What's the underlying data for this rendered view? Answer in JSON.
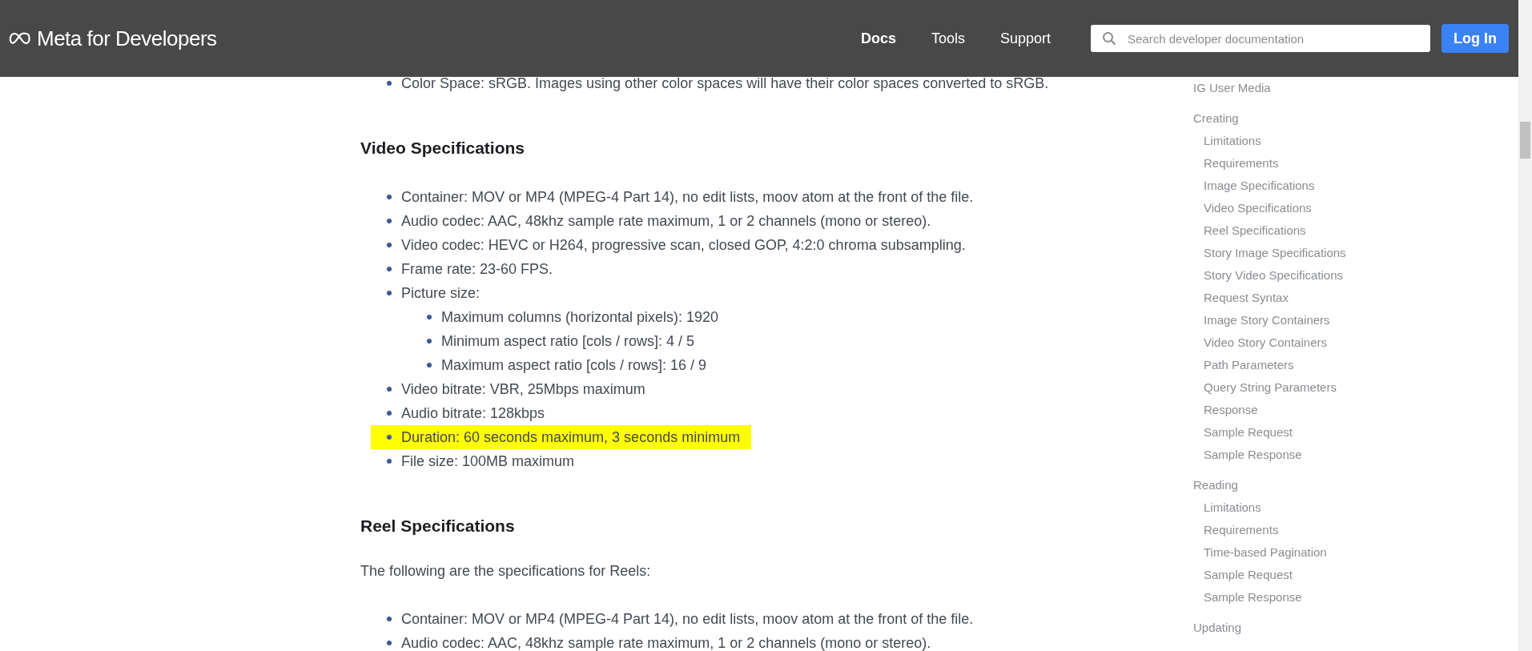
{
  "header": {
    "logo": "Meta for Developers",
    "nav": [
      {
        "label": "Docs",
        "selected": true
      },
      {
        "label": "Tools",
        "selected": false
      },
      {
        "label": "Support",
        "selected": false
      }
    ],
    "search": {
      "placeholder": "Search developer documentation"
    },
    "login": "Log In"
  },
  "content": [
    {
      "kind": "list",
      "items": [
        {
          "text": "Color Space: sRGB. Images using other color spaces will have their color spaces converted to sRGB.",
          "highlighted": false
        }
      ]
    },
    {
      "kind": "heading",
      "text": "Video Specifications"
    },
    {
      "kind": "list",
      "items": [
        {
          "text": "Container: MOV or MP4 (MPEG-4 Part 14), no edit lists, moov atom at the front of the file.",
          "highlighted": false
        },
        {
          "text": "Audio codec: AAC, 48khz sample rate maximum, 1 or 2 channels (mono or stereo).",
          "highlighted": false
        },
        {
          "text": "Video codec: HEVC or H264, progressive scan, closed GOP, 4:2:0 chroma subsampling.",
          "highlighted": false
        },
        {
          "text": "Frame rate: 23-60 FPS.",
          "highlighted": false
        },
        {
          "text": "Picture size:",
          "highlighted": false,
          "children": [
            {
              "text": "Maximum columns (horizontal pixels): 1920",
              "highlighted": false
            },
            {
              "text": "Minimum aspect ratio [cols / rows]: 4 / 5",
              "highlighted": false
            },
            {
              "text": "Maximum aspect ratio [cols / rows]: 16 / 9",
              "highlighted": false
            }
          ]
        },
        {
          "text": "Video bitrate: VBR, 25Mbps maximum",
          "highlighted": false
        },
        {
          "text": "Audio bitrate: 128kbps",
          "highlighted": false
        },
        {
          "text": "Duration: 60 seconds maximum, 3 seconds minimum",
          "highlighted": true
        },
        {
          "text": "File size: 100MB maximum",
          "highlighted": false
        }
      ]
    },
    {
      "kind": "heading",
      "text": "Reel Specifications"
    },
    {
      "kind": "paragraph",
      "text": "The following are the specifications for Reels:"
    },
    {
      "kind": "list",
      "items": [
        {
          "text": "Container: MOV or MP4 (MPEG-4 Part 14), no edit lists, moov atom at the front of the file.",
          "highlighted": false
        },
        {
          "text": "Audio codec: AAC, 48khz sample rate maximum, 1 or 2 channels (mono or stereo).",
          "highlighted": false
        }
      ]
    }
  ],
  "sidebar": {
    "items": [
      {
        "label": "IG User Media"
      },
      {
        "label": "Creating",
        "children": [
          {
            "label": "Limitations"
          },
          {
            "label": "Requirements"
          },
          {
            "label": "Image Specifications"
          },
          {
            "label": "Video Specifications"
          },
          {
            "label": "Reel Specifications"
          },
          {
            "label": "Story Image Specifications"
          },
          {
            "label": "Story Video Specifications"
          },
          {
            "label": "Request Syntax"
          },
          {
            "label": "Image Story Containers"
          },
          {
            "label": "Video Story Containers"
          },
          {
            "label": "Path Parameters"
          },
          {
            "label": "Query String Parameters"
          },
          {
            "label": "Response"
          },
          {
            "label": "Sample Request"
          },
          {
            "label": "Sample Response"
          }
        ]
      },
      {
        "label": "Reading",
        "children": [
          {
            "label": "Limitations"
          },
          {
            "label": "Requirements"
          },
          {
            "label": "Time-based Pagination"
          },
          {
            "label": "Sample Request"
          },
          {
            "label": "Sample Response"
          }
        ]
      },
      {
        "label": "Updating"
      }
    ]
  }
}
